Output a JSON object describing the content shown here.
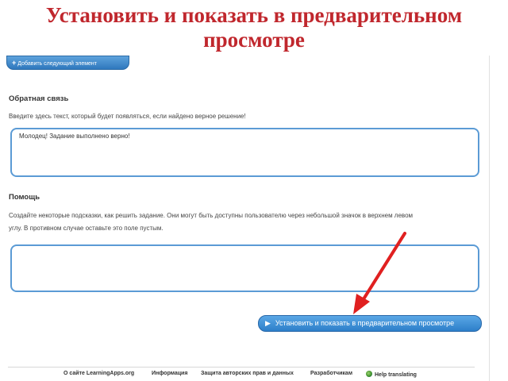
{
  "title": "Установить и показать в предварительном просмотре",
  "add_button": {
    "label": "Добавить следующий элемент"
  },
  "feedback": {
    "heading": "Обратная связь",
    "description": "Введите здесь текст, который будет появляться, если найдено верное решение!",
    "value": "Молодец! Задание выполнено верно!"
  },
  "help": {
    "heading": "Помощь",
    "description_line1": "Создайте некоторые подсказки, как решить задание. Они могут быть доступны пользователю через небольшой значок в верхнем левом",
    "description_line2": "углу. В противном случае оставьте это поле пустым.",
    "value": ""
  },
  "preview_button": {
    "label": "Установить и показать в предварительном просмотре"
  },
  "footer": {
    "links": [
      "О сайте LearningApps.org",
      "Информация",
      "Защита авторских прав и данных",
      "Разработчикам",
      "Help translating"
    ]
  },
  "colors": {
    "title": "#c0272d",
    "accent": "#2d7fc9",
    "arrow": "#e02020"
  },
  "icons": {
    "plus": "plus-icon",
    "play": "play-icon",
    "globe": "globe-icon",
    "arrow": "red-arrow-annotation"
  }
}
